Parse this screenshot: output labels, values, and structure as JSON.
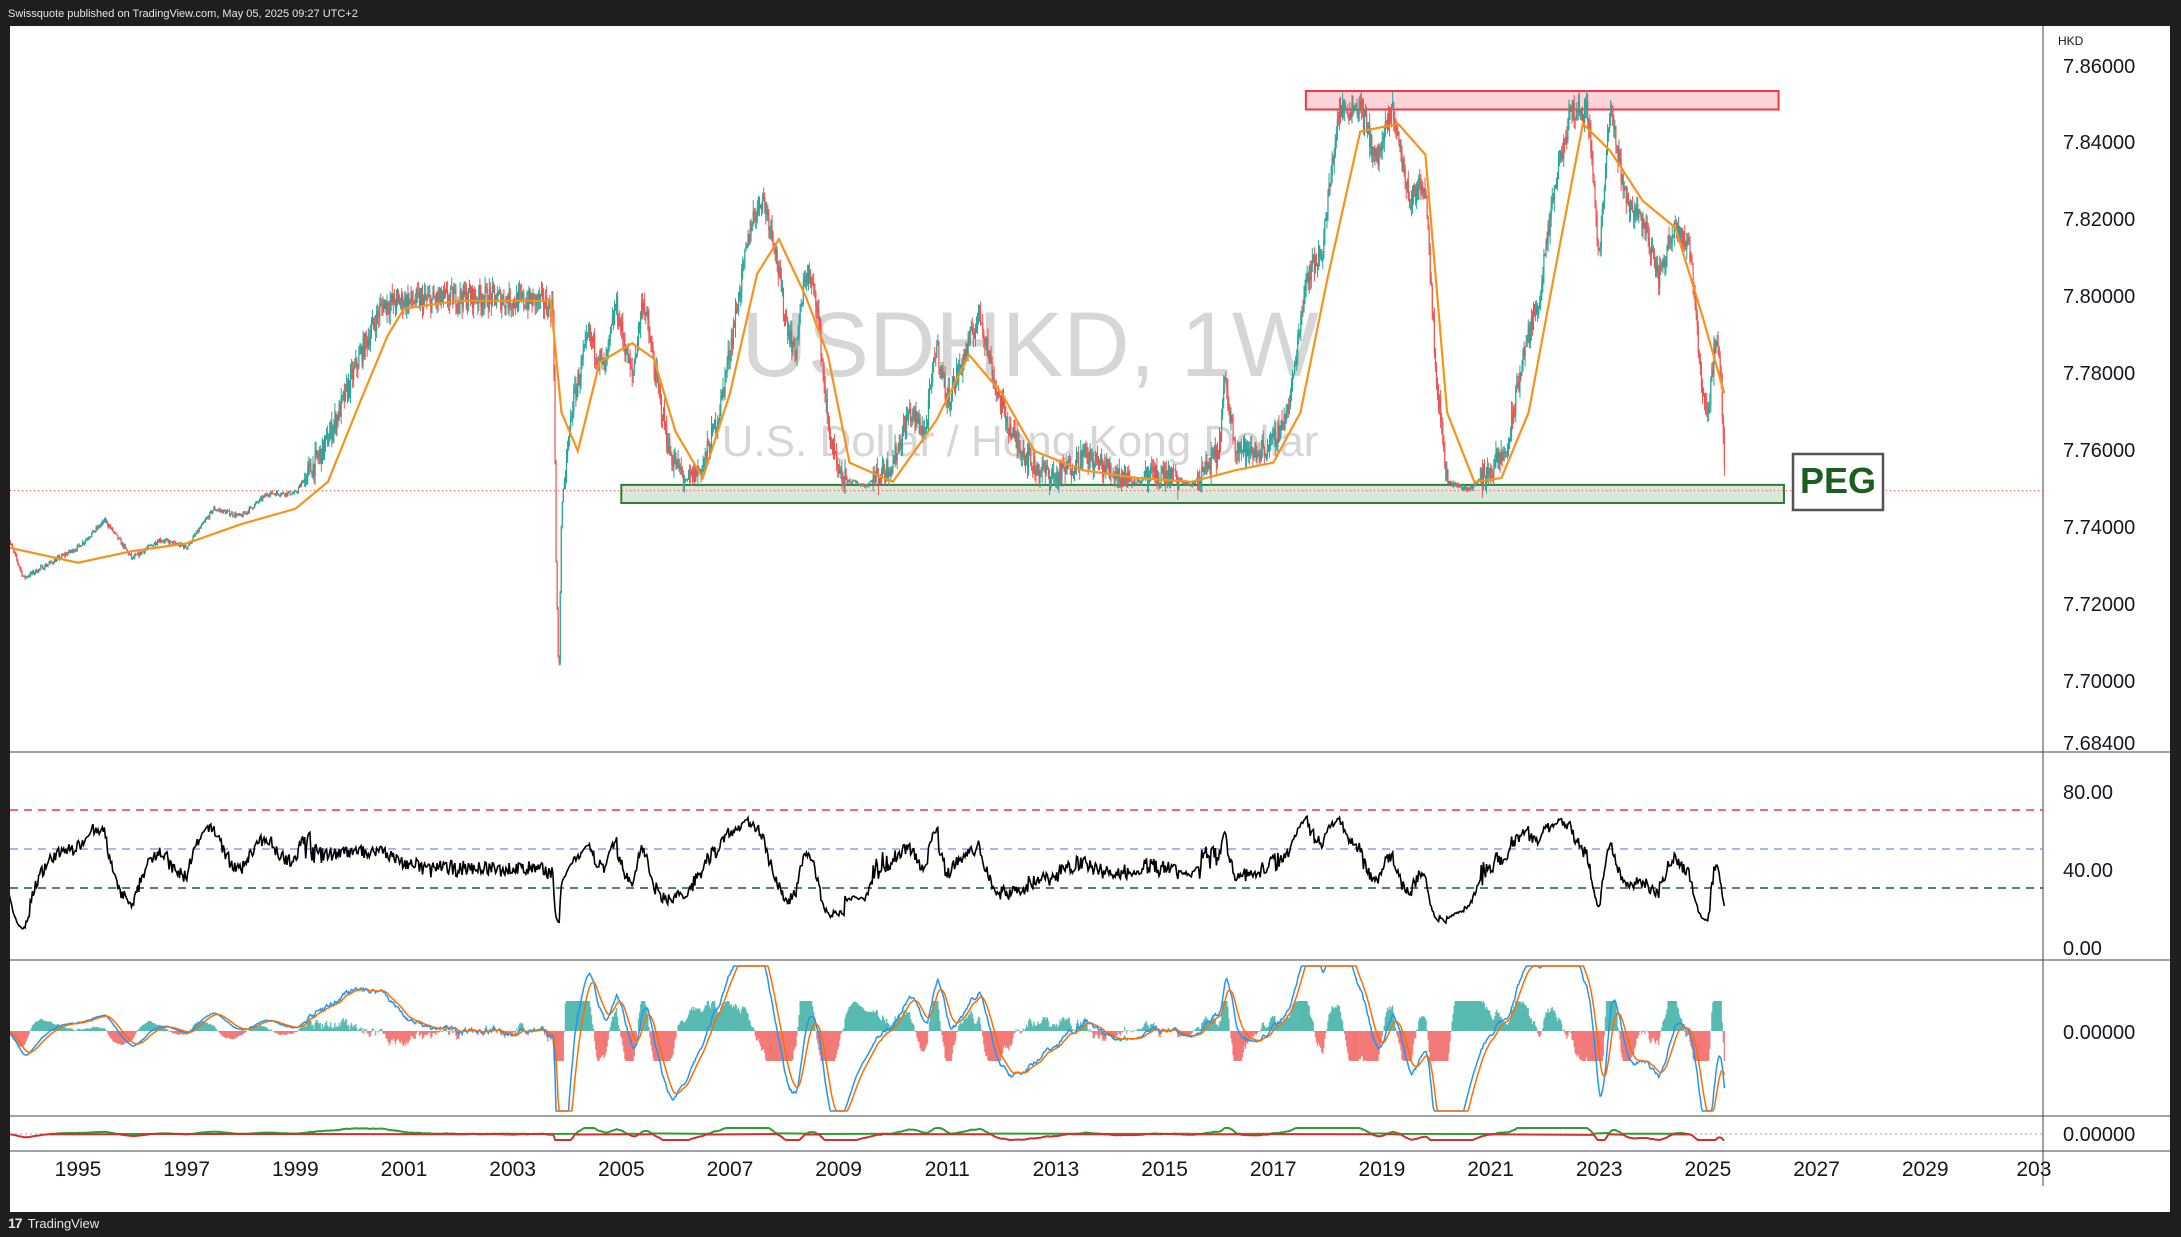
{
  "header": {
    "published_text": "Swissquote published on TradingView.com, May 05, 2025 09:27 UTC+2"
  },
  "footer": {
    "brand": "TradingView",
    "logo_glyph": "17"
  },
  "watermark": {
    "symbol": "USDHKD, 1W",
    "description": "U.S. Dollar / Hong Kong Dollar"
  },
  "price_axis": {
    "currency": "HKD",
    "ticks": [
      "7.86000",
      "7.84000",
      "7.82000",
      "7.80000",
      "7.78000",
      "7.76000",
      "7.74000",
      "7.72000",
      "7.70000",
      "7.68400"
    ]
  },
  "time_axis": {
    "ticks": [
      "1995",
      "1997",
      "1999",
      "2001",
      "2003",
      "2005",
      "2007",
      "2009",
      "2011",
      "2013",
      "2015",
      "2017",
      "2019",
      "2021",
      "2023",
      "2025",
      "2027",
      "2029",
      "203"
    ]
  },
  "annotations": {
    "peg_label": "PEG",
    "peg_color": "#1b5e20",
    "resistance_color": "#f23645",
    "support_color": "#2e7d32"
  },
  "rsi_panel": {
    "ticks": [
      "80.00",
      "40.00",
      "0.00"
    ]
  },
  "macd_panel": {
    "ticks": [
      "0.00000"
    ]
  },
  "bottom_panel": {
    "ticks": [
      "0.00000"
    ]
  },
  "colors": {
    "candle_up": "#26a69a",
    "candle_down": "#ef5350",
    "ma_line": "#f7931a",
    "rsi_line": "#000000",
    "macd_line": "#2196f3",
    "signal_line": "#ff6d00"
  },
  "chart_data": {
    "type": "line",
    "x_unit": "year",
    "y_unit": "HKD",
    "ylim": [
      7.684,
      7.862
    ],
    "series": [
      {
        "points": [
          [
            1993.7,
            7.738
          ],
          [
            1994.0,
            7.727
          ],
          [
            1994.5,
            7.731
          ],
          [
            1995.0,
            7.735
          ],
          [
            1995.5,
            7.742
          ],
          [
            1996.0,
            7.732
          ],
          [
            1996.5,
            7.737
          ],
          [
            1997.0,
            7.735
          ],
          [
            1997.5,
            7.745
          ],
          [
            1998.0,
            7.743
          ],
          [
            1998.5,
            7.749
          ],
          [
            1999.0,
            7.749
          ],
          [
            1999.5,
            7.76
          ],
          [
            1999.8,
            7.77
          ],
          [
            2000.2,
            7.785
          ],
          [
            2000.6,
            7.798
          ],
          [
            2001.0,
            7.799
          ],
          [
            2001.5,
            7.799
          ],
          [
            2002.0,
            7.8
          ],
          [
            2002.5,
            7.8
          ],
          [
            2003.0,
            7.799
          ],
          [
            2003.5,
            7.799
          ],
          [
            2003.75,
            7.797
          ],
          [
            2003.8,
            7.73
          ],
          [
            2003.85,
            7.699
          ],
          [
            2003.9,
            7.745
          ],
          [
            2004.1,
            7.772
          ],
          [
            2004.4,
            7.79
          ],
          [
            2004.7,
            7.781
          ],
          [
            2004.9,
            7.798
          ],
          [
            2005.2,
            7.779
          ],
          [
            2005.4,
            7.8
          ],
          [
            2005.6,
            7.782
          ],
          [
            2005.9,
            7.759
          ],
          [
            2006.2,
            7.752
          ],
          [
            2006.5,
            7.756
          ],
          [
            2006.8,
            7.77
          ],
          [
            2007.1,
            7.795
          ],
          [
            2007.4,
            7.82
          ],
          [
            2007.6,
            7.826
          ],
          [
            2007.8,
            7.816
          ],
          [
            2008.0,
            7.796
          ],
          [
            2008.2,
            7.785
          ],
          [
            2008.4,
            7.807
          ],
          [
            2008.6,
            7.799
          ],
          [
            2008.8,
            7.767
          ],
          [
            2009.0,
            7.753
          ],
          [
            2009.5,
            7.751
          ],
          [
            2010.0,
            7.757
          ],
          [
            2010.3,
            7.77
          ],
          [
            2010.6,
            7.765
          ],
          [
            2010.8,
            7.788
          ],
          [
            2011.0,
            7.773
          ],
          [
            2011.3,
            7.784
          ],
          [
            2011.6,
            7.796
          ],
          [
            2011.9,
            7.776
          ],
          [
            2012.2,
            7.764
          ],
          [
            2012.6,
            7.756
          ],
          [
            2013.0,
            7.753
          ],
          [
            2013.5,
            7.759
          ],
          [
            2014.0,
            7.755
          ],
          [
            2014.5,
            7.752
          ],
          [
            2015.0,
            7.754
          ],
          [
            2015.5,
            7.751
          ],
          [
            2015.8,
            7.756
          ],
          [
            2016.0,
            7.76
          ],
          [
            2016.1,
            7.778
          ],
          [
            2016.3,
            7.762
          ],
          [
            2016.6,
            7.759
          ],
          [
            2017.0,
            7.762
          ],
          [
            2017.3,
            7.772
          ],
          [
            2017.6,
            7.805
          ],
          [
            2017.9,
            7.812
          ],
          [
            2018.2,
            7.848
          ],
          [
            2018.6,
            7.85
          ],
          [
            2018.9,
            7.835
          ],
          [
            2019.2,
            7.849
          ],
          [
            2019.5,
            7.825
          ],
          [
            2019.8,
            7.83
          ],
          [
            2020.0,
            7.78
          ],
          [
            2020.2,
            7.752
          ],
          [
            2020.6,
            7.75
          ],
          [
            2021.0,
            7.755
          ],
          [
            2021.3,
            7.76
          ],
          [
            2021.6,
            7.785
          ],
          [
            2021.9,
            7.8
          ],
          [
            2022.2,
            7.83
          ],
          [
            2022.5,
            7.849
          ],
          [
            2022.8,
            7.848
          ],
          [
            2023.0,
            7.81
          ],
          [
            2023.2,
            7.849
          ],
          [
            2023.5,
            7.825
          ],
          [
            2023.8,
            7.82
          ],
          [
            2024.1,
            7.805
          ],
          [
            2024.4,
            7.82
          ],
          [
            2024.7,
            7.81
          ],
          [
            2024.9,
            7.775
          ],
          [
            2025.0,
            7.77
          ],
          [
            2025.15,
            7.79
          ],
          [
            2025.25,
            7.775
          ],
          [
            2025.32,
            7.752
          ]
        ]
      },
      {
        "points": [
          [
            1993.7,
            7.735
          ],
          [
            1995.0,
            7.731
          ],
          [
            1996.0,
            7.734
          ],
          [
            1997.0,
            7.736
          ],
          [
            1998.0,
            7.741
          ],
          [
            1999.0,
            7.745
          ],
          [
            1999.6,
            7.752
          ],
          [
            2000.2,
            7.773
          ],
          [
            2000.7,
            7.79
          ],
          [
            2001.0,
            7.797
          ],
          [
            2002.0,
            7.799
          ],
          [
            2003.7,
            7.799
          ],
          [
            2003.9,
            7.77
          ],
          [
            2004.2,
            7.76
          ],
          [
            2004.6,
            7.783
          ],
          [
            2005.2,
            7.788
          ],
          [
            2005.6,
            7.784
          ],
          [
            2006.0,
            7.765
          ],
          [
            2006.5,
            7.753
          ],
          [
            2007.0,
            7.775
          ],
          [
            2007.5,
            7.806
          ],
          [
            2007.9,
            7.815
          ],
          [
            2008.4,
            7.8
          ],
          [
            2008.8,
            7.785
          ],
          [
            2009.2,
            7.757
          ],
          [
            2010.0,
            7.752
          ],
          [
            2010.8,
            7.768
          ],
          [
            2011.4,
            7.785
          ],
          [
            2012.0,
            7.775
          ],
          [
            2012.6,
            7.76
          ],
          [
            2013.5,
            7.755
          ],
          [
            2014.5,
            7.753
          ],
          [
            2015.5,
            7.752
          ],
          [
            2016.3,
            7.755
          ],
          [
            2017.0,
            7.757
          ],
          [
            2017.5,
            7.77
          ],
          [
            2018.0,
            7.805
          ],
          [
            2018.6,
            7.843
          ],
          [
            2019.3,
            7.845
          ],
          [
            2019.8,
            7.837
          ],
          [
            2020.2,
            7.77
          ],
          [
            2020.7,
            7.752
          ],
          [
            2021.2,
            7.753
          ],
          [
            2021.7,
            7.77
          ],
          [
            2022.2,
            7.808
          ],
          [
            2022.7,
            7.845
          ],
          [
            2023.2,
            7.838
          ],
          [
            2023.8,
            7.825
          ],
          [
            2024.4,
            7.818
          ],
          [
            2024.9,
            7.795
          ],
          [
            2025.3,
            7.775
          ]
        ]
      }
    ]
  }
}
